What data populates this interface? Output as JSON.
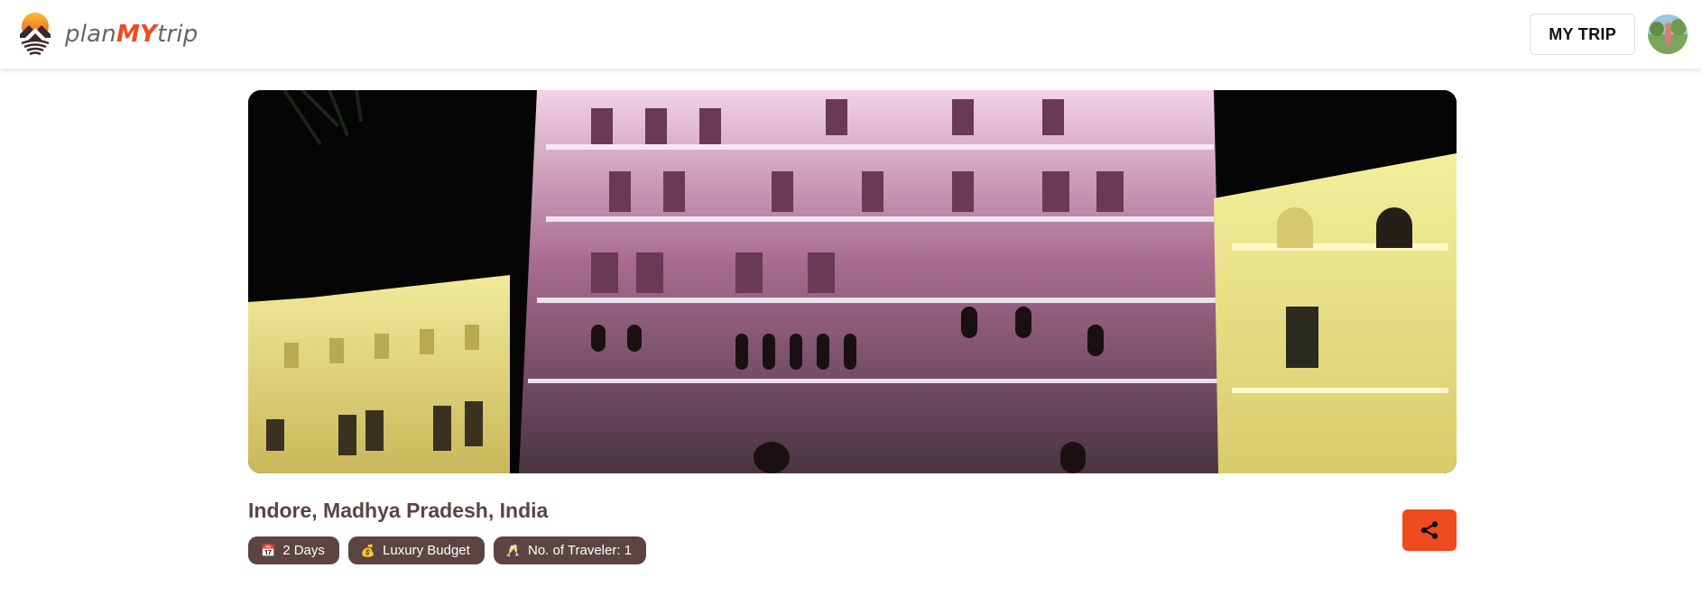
{
  "header": {
    "brand": {
      "prefix": "plan",
      "middle": "MY",
      "suffix": "trip"
    },
    "my_trip_label": "MY TRIP",
    "avatar_icon": "user-avatar"
  },
  "hero": {
    "image_subject": "illuminated palace facade at night"
  },
  "trip": {
    "location": "Indore, Madhya Pradesh, India",
    "chips": [
      {
        "icon": "calendar-icon",
        "glyph": "📅",
        "label": "2 Days"
      },
      {
        "icon": "money-bag-icon",
        "glyph": "💰",
        "label": "Luxury Budget"
      },
      {
        "icon": "toast-icon",
        "glyph": "🥂",
        "label": "No. of Traveler: 1"
      }
    ]
  },
  "share": {
    "icon": "share-icon"
  },
  "colors": {
    "accent": "#f04a1f",
    "chip_bg": "#5b4443",
    "title": "#5b4443"
  }
}
